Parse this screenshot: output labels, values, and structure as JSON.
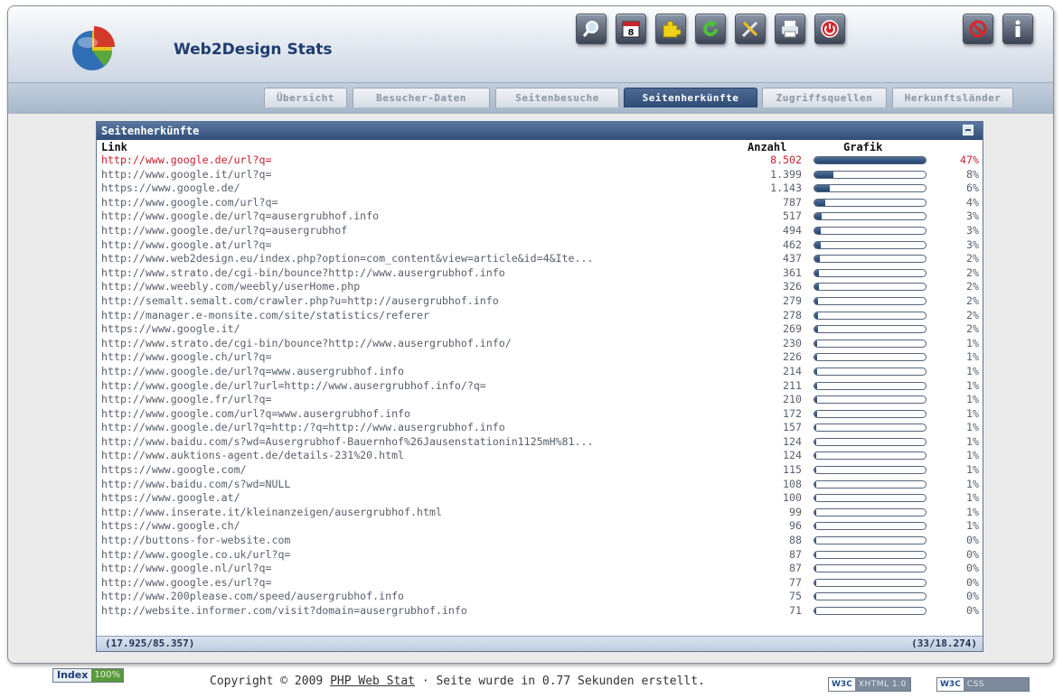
{
  "app": {
    "title": "Web2Design Stats"
  },
  "toolbar": [
    {
      "icon": "search-icon"
    },
    {
      "icon": "calendar-icon",
      "text": "8"
    },
    {
      "icon": "puzzle-icon"
    },
    {
      "icon": "refresh-icon"
    },
    {
      "icon": "tools-icon"
    },
    {
      "icon": "print-icon"
    },
    {
      "icon": "power-icon"
    },
    {
      "icon": "block-icon"
    },
    {
      "icon": "info-icon"
    }
  ],
  "tabs": [
    {
      "label": "Übersicht",
      "active": false
    },
    {
      "label": "Besucher-Daten",
      "active": false
    },
    {
      "label": "Seitenbesuche",
      "active": false
    },
    {
      "label": "Seitenherkünfte",
      "active": true
    },
    {
      "label": "Zugriffsquellen",
      "active": false
    },
    {
      "label": "Herkunftsländer",
      "active": false
    }
  ],
  "panel": {
    "title": "Seitenherkünfte",
    "col_link": "Link",
    "col_count": "Anzahl",
    "col_graph": "Grafik",
    "footer_left": "(17.925/85.357)",
    "footer_right": "(33/18.274)"
  },
  "rows": [
    {
      "link": "http://www.google.de/url?q=",
      "count": "8.502",
      "pct": "47%",
      "share": 0.47
    },
    {
      "link": "http://www.google.it/url?q=",
      "count": "1.399",
      "pct": "8%",
      "share": 0.08
    },
    {
      "link": "https://www.google.de/",
      "count": "1.143",
      "pct": "6%",
      "share": 0.064
    },
    {
      "link": "http://www.google.com/url?q=",
      "count": "787",
      "pct": "4%",
      "share": 0.044
    },
    {
      "link": "http://www.google.de/url?q=ausergrubhof.info",
      "count": "517",
      "pct": "3%",
      "share": 0.029
    },
    {
      "link": "http://www.google.de/url?q=ausergrubhof",
      "count": "494",
      "pct": "3%",
      "share": 0.028
    },
    {
      "link": "http://www.google.at/url?q=",
      "count": "462",
      "pct": "3%",
      "share": 0.026
    },
    {
      "link": "http://www.web2design.eu/index.php?option=com_content&view=article&id=4&Ite...",
      "count": "437",
      "pct": "2%",
      "share": 0.024
    },
    {
      "link": "http://www.strato.de/cgi-bin/bounce?http://www.ausergrubhof.info",
      "count": "361",
      "pct": "2%",
      "share": 0.02
    },
    {
      "link": "http://www.weebly.com/weebly/userHome.php",
      "count": "326",
      "pct": "2%",
      "share": 0.018
    },
    {
      "link": "http://semalt.semalt.com/crawler.php?u=http://ausergrubhof.info",
      "count": "279",
      "pct": "2%",
      "share": 0.016
    },
    {
      "link": "http://manager.e-monsite.com/site/statistics/referer",
      "count": "278",
      "pct": "2%",
      "share": 0.016
    },
    {
      "link": "https://www.google.it/",
      "count": "269",
      "pct": "2%",
      "share": 0.015
    },
    {
      "link": "http://www.strato.de/cgi-bin/bounce?http://www.ausergrubhof.info/",
      "count": "230",
      "pct": "1%",
      "share": 0.013
    },
    {
      "link": "http://www.google.ch/url?q=",
      "count": "226",
      "pct": "1%",
      "share": 0.013
    },
    {
      "link": "http://www.google.de/url?q=www.ausergrubhof.info",
      "count": "214",
      "pct": "1%",
      "share": 0.012
    },
    {
      "link": "http://www.google.de/url?url=http://www.ausergrubhof.info/?q=",
      "count": "211",
      "pct": "1%",
      "share": 0.012
    },
    {
      "link": "http://www.google.fr/url?q=",
      "count": "210",
      "pct": "1%",
      "share": 0.012
    },
    {
      "link": "http://www.google.com/url?q=www.ausergrubhof.info",
      "count": "172",
      "pct": "1%",
      "share": 0.01
    },
    {
      "link": "http://www.google.de/url?q=http:/?q=http://www.ausergrubhof.info",
      "count": "157",
      "pct": "1%",
      "share": 0.009
    },
    {
      "link": "http://www.baidu.com/s?wd=Ausergrubhof-Bauernhof%26Jausenstationin1125mH%81...",
      "count": "124",
      "pct": "1%",
      "share": 0.007
    },
    {
      "link": "http://www.auktions-agent.de/details-231%20.html",
      "count": "124",
      "pct": "1%",
      "share": 0.007
    },
    {
      "link": "https://www.google.com/",
      "count": "115",
      "pct": "1%",
      "share": 0.006
    },
    {
      "link": "http://www.baidu.com/s?wd=NULL",
      "count": "108",
      "pct": "1%",
      "share": 0.006
    },
    {
      "link": "https://www.google.at/",
      "count": "100",
      "pct": "1%",
      "share": 0.006
    },
    {
      "link": "http://www.inserate.it/kleinanzeigen/ausergrubhof.html",
      "count": "99",
      "pct": "1%",
      "share": 0.006
    },
    {
      "link": "https://www.google.ch/",
      "count": "96",
      "pct": "1%",
      "share": 0.005
    },
    {
      "link": "http://buttons-for-website.com",
      "count": "88",
      "pct": "0%",
      "share": 0.005
    },
    {
      "link": "http://www.google.co.uk/url?q=",
      "count": "87",
      "pct": "0%",
      "share": 0.005
    },
    {
      "link": "http://www.google.nl/url?q=",
      "count": "87",
      "pct": "0%",
      "share": 0.005
    },
    {
      "link": "http://www.google.es/url?q=",
      "count": "77",
      "pct": "0%",
      "share": 0.004
    },
    {
      "link": "http://www.200please.com/speed/ausergrubhof.info",
      "count": "75",
      "pct": "0%",
      "share": 0.004
    },
    {
      "link": "http://website.informer.com/visit?domain=ausergrubhof.info",
      "count": "71",
      "pct": "0%",
      "share": 0.004
    }
  ],
  "footer": {
    "index_label": "Index",
    "index_value": "100%",
    "copyright_prefix": "Copyright © 2009",
    "copyright_link": "PHP Web Stat",
    "copyright_suffix": "· Seite wurde in 0.77 Sekunden erstellt.",
    "w3c_logo": "W3C",
    "w3c_xhtml": "XHTML 1.0",
    "w3c_css": "CSS"
  },
  "colors": {
    "accent": "#2f4d78",
    "highlight": "#c6202c"
  }
}
